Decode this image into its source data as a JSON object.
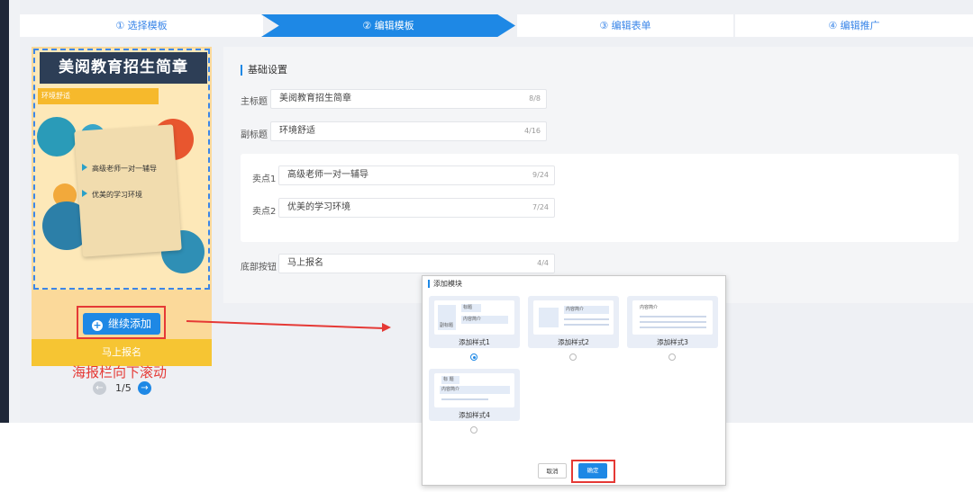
{
  "steps": [
    {
      "label": "① 选择模板"
    },
    {
      "label": "② 编辑模板"
    },
    {
      "label": "③ 编辑表单"
    },
    {
      "label": "④ 编辑推广"
    }
  ],
  "poster": {
    "title": "美阅教育招生简章",
    "subtitle": "环境舒适",
    "items": [
      "高级老师一对一辅导",
      "优美的学习环境"
    ],
    "continue_label": "继续添加",
    "bottom_button": "马上报名",
    "scroll_note": "海报栏向下滚动",
    "pager": "1/5"
  },
  "form": {
    "section_title": "基础设置",
    "main_title_label": "主标题",
    "main_title_value": "美阅教育招生简章",
    "main_title_count": "8/8",
    "sub_title_label": "副标题",
    "sub_title_value": "环境舒适",
    "sub_title_count": "4/16",
    "selling1_label": "卖点1",
    "selling1_value": "高级老师一对一辅导",
    "selling1_count": "9/24",
    "selling2_label": "卖点2",
    "selling2_value": "优美的学习环境",
    "selling2_count": "7/24",
    "bottom_button_label": "底部按钮",
    "bottom_button_value": "马上报名",
    "bottom_button_count": "4/4"
  },
  "dialog": {
    "title": "添加模块",
    "options": [
      {
        "label": "添加样式1",
        "chip_title": "标题",
        "chip_sub": "副标题",
        "chip_content": "内容简介",
        "selected": true
      },
      {
        "label": "添加样式2",
        "chip_content": "内容简介",
        "selected": false
      },
      {
        "label": "添加样式3",
        "chip_content": "内容简介",
        "selected": false
      },
      {
        "label": "添加样式4",
        "chip_title": "标 题",
        "chip_content": "内容简介",
        "selected": false
      }
    ],
    "cancel_label": "取消",
    "confirm_label": "确定"
  },
  "colors": {
    "accent": "#1e88e5",
    "annotation_red": "#e53935",
    "poster_title_bg": "#2d3e56",
    "poster_yellow": "#f6c533"
  }
}
